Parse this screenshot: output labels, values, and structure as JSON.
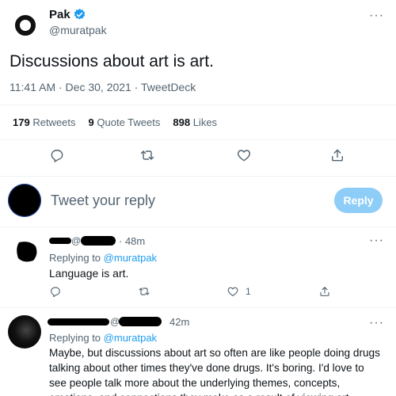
{
  "tweet": {
    "author_name": "Pak",
    "author_handle": "@muratpak",
    "text": "Discussions about art is art.",
    "timestamp": "11:41 AM · Dec 30, 2021 · TweetDeck",
    "stats": {
      "retweets_count": "179",
      "retweets_label": "Retweets",
      "quotes_count": "9",
      "quotes_label": "Quote Tweets",
      "likes_count": "898",
      "likes_label": "Likes"
    },
    "more_label": "···"
  },
  "composer": {
    "placeholder": "Tweet your reply",
    "reply_button": "Reply"
  },
  "replies": [
    {
      "time": "· 48m",
      "replying_prefix": "Replying to",
      "replying_to": "@muratpak",
      "text": "Language is art.",
      "like_count": "1",
      "more_label": "···"
    },
    {
      "time": "42m",
      "replying_prefix": "Replying to",
      "replying_to": "@muratpak",
      "text": "Maybe, but discussions about art so often are like people doing drugs talking about other times they've done drugs. It's boring. I'd love to see people talk more about the underlying themes, concepts, emotions, and connections they make as a result of viewing art.",
      "more_label": "···"
    }
  ],
  "colors": {
    "accent": "#1d9bf0",
    "reply_button_disabled": "#8ecdf8",
    "verified_badge": "#1d9bf0"
  },
  "icons": [
    "reply-icon",
    "retweet-icon",
    "like-icon",
    "bookmark-icon",
    "share-icon",
    "verified-badge-icon",
    "more-icon"
  ]
}
